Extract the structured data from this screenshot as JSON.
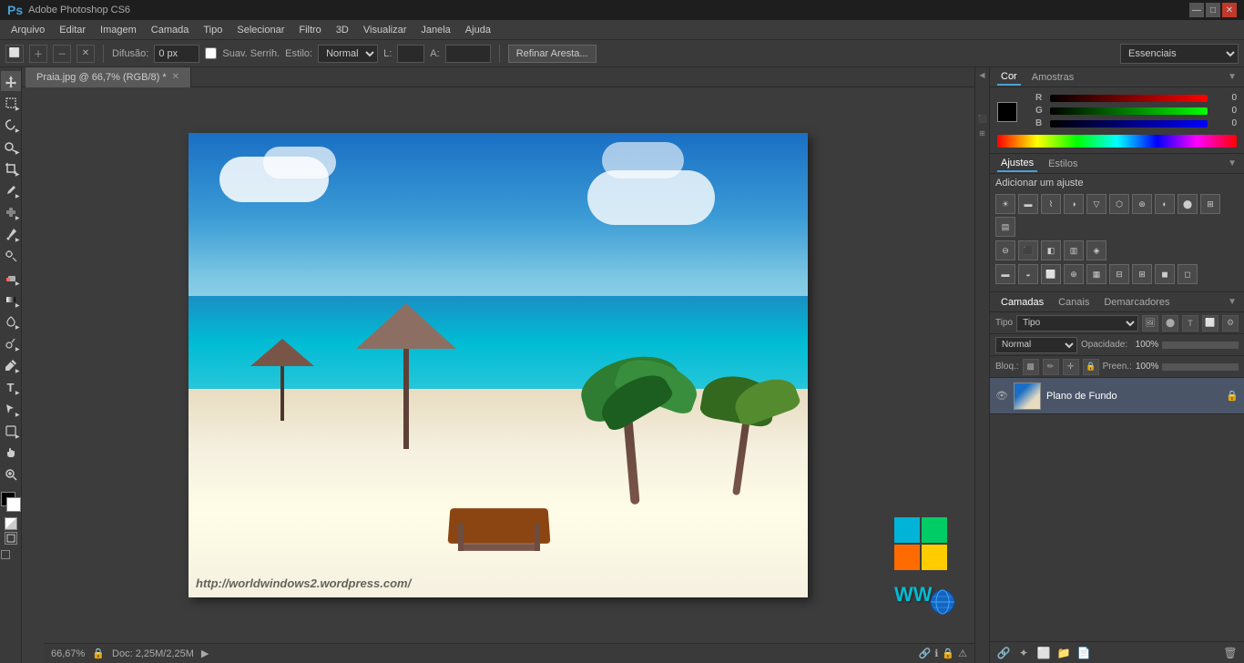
{
  "titlebar": {
    "logo": "Ps",
    "title": "Adobe Photoshop CS6",
    "min_btn": "—",
    "max_btn": "□",
    "close_btn": "✕"
  },
  "menubar": {
    "items": [
      "Arquivo",
      "Editar",
      "Imagem",
      "Camada",
      "Tipo",
      "Selecionar",
      "Filtro",
      "3D",
      "Visualizar",
      "Janela",
      "Ajuda"
    ]
  },
  "optionsbar": {
    "diffusion_label": "Difusão:",
    "diffusion_value": "0 px",
    "smooth_label": "Suav. Serrih.",
    "style_label": "Estilo:",
    "style_value": "Normal",
    "refine_btn": "Refinar Aresta...",
    "workspace_value": "Essenciais"
  },
  "tabs": {
    "active": "Praia.jpg @ 66,7% (RGB/8) *"
  },
  "color_panel": {
    "tab1": "Cor",
    "tab2": "Amostras",
    "r_label": "R",
    "r_value": "0",
    "g_label": "G",
    "g_value": "0",
    "b_label": "B",
    "b_value": "0"
  },
  "adjustments_panel": {
    "tab1": "Ajustes",
    "tab2": "Estilos",
    "title": "Adicionar um ajuste"
  },
  "layers_panel": {
    "tab1": "Camadas",
    "tab2": "Canais",
    "tab3": "Demarcadores",
    "filter_label": "Tipo",
    "blend_mode": "Normal",
    "opacity_label": "Opacidade:",
    "opacity_value": "100%",
    "lock_label": "Bloq.:",
    "fill_label": "Preen.:",
    "fill_value": "100%",
    "layer_name": "Plano de Fundo"
  },
  "statusbar": {
    "zoom": "66,67%",
    "doc_info": "Doc: 2,25M/2,25M",
    "watermark": "http://worldwindows2.wordpress.com/"
  },
  "tools": [
    "move",
    "marquee",
    "lasso",
    "quick-select",
    "crop",
    "eyedropper",
    "heal",
    "brush",
    "clone",
    "eraser",
    "gradient",
    "blur",
    "dodge",
    "pen",
    "type",
    "path-select",
    "shape",
    "hand",
    "zoom"
  ]
}
